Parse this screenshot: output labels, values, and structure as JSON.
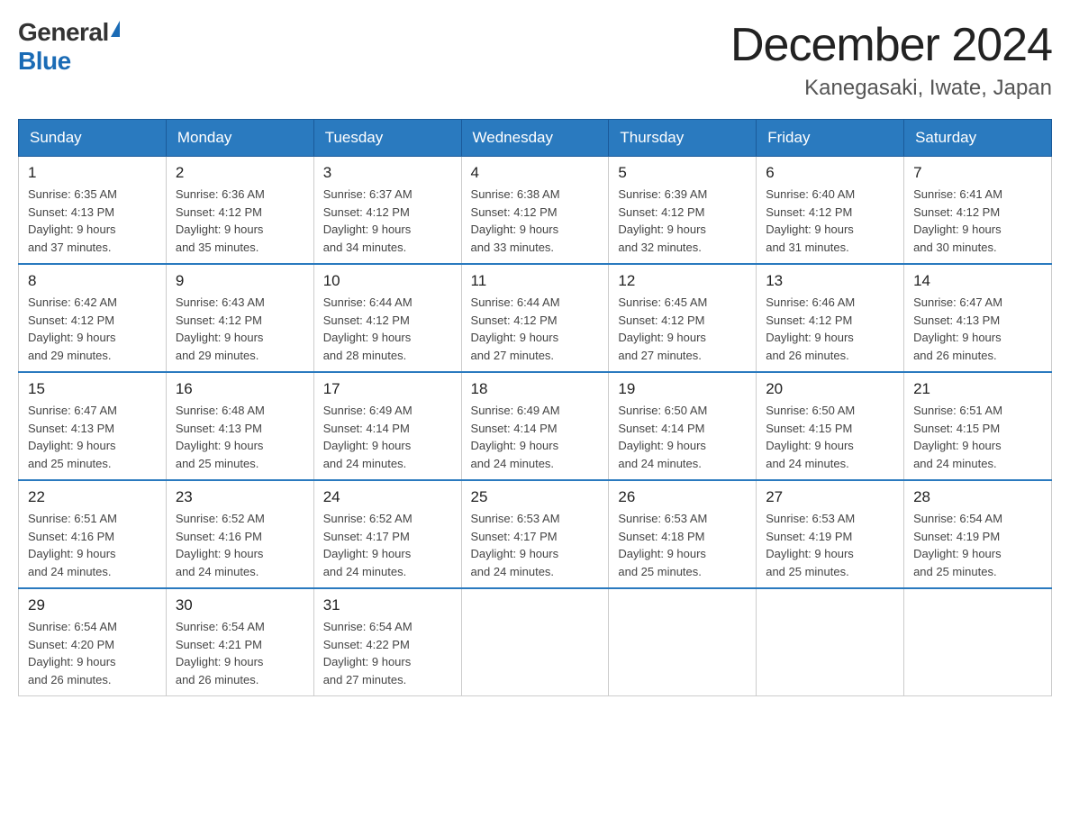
{
  "logo": {
    "general": "General",
    "blue": "Blue"
  },
  "title": "December 2024",
  "location": "Kanegasaki, Iwate, Japan",
  "days_of_week": [
    "Sunday",
    "Monday",
    "Tuesday",
    "Wednesday",
    "Thursday",
    "Friday",
    "Saturday"
  ],
  "weeks": [
    [
      {
        "day": "1",
        "sunrise": "6:35 AM",
        "sunset": "4:13 PM",
        "daylight": "9 hours and 37 minutes."
      },
      {
        "day": "2",
        "sunrise": "6:36 AM",
        "sunset": "4:12 PM",
        "daylight": "9 hours and 35 minutes."
      },
      {
        "day": "3",
        "sunrise": "6:37 AM",
        "sunset": "4:12 PM",
        "daylight": "9 hours and 34 minutes."
      },
      {
        "day": "4",
        "sunrise": "6:38 AM",
        "sunset": "4:12 PM",
        "daylight": "9 hours and 33 minutes."
      },
      {
        "day": "5",
        "sunrise": "6:39 AM",
        "sunset": "4:12 PM",
        "daylight": "9 hours and 32 minutes."
      },
      {
        "day": "6",
        "sunrise": "6:40 AM",
        "sunset": "4:12 PM",
        "daylight": "9 hours and 31 minutes."
      },
      {
        "day": "7",
        "sunrise": "6:41 AM",
        "sunset": "4:12 PM",
        "daylight": "9 hours and 30 minutes."
      }
    ],
    [
      {
        "day": "8",
        "sunrise": "6:42 AM",
        "sunset": "4:12 PM",
        "daylight": "9 hours and 29 minutes."
      },
      {
        "day": "9",
        "sunrise": "6:43 AM",
        "sunset": "4:12 PM",
        "daylight": "9 hours and 29 minutes."
      },
      {
        "day": "10",
        "sunrise": "6:44 AM",
        "sunset": "4:12 PM",
        "daylight": "9 hours and 28 minutes."
      },
      {
        "day": "11",
        "sunrise": "6:44 AM",
        "sunset": "4:12 PM",
        "daylight": "9 hours and 27 minutes."
      },
      {
        "day": "12",
        "sunrise": "6:45 AM",
        "sunset": "4:12 PM",
        "daylight": "9 hours and 27 minutes."
      },
      {
        "day": "13",
        "sunrise": "6:46 AM",
        "sunset": "4:12 PM",
        "daylight": "9 hours and 26 minutes."
      },
      {
        "day": "14",
        "sunrise": "6:47 AM",
        "sunset": "4:13 PM",
        "daylight": "9 hours and 26 minutes."
      }
    ],
    [
      {
        "day": "15",
        "sunrise": "6:47 AM",
        "sunset": "4:13 PM",
        "daylight": "9 hours and 25 minutes."
      },
      {
        "day": "16",
        "sunrise": "6:48 AM",
        "sunset": "4:13 PM",
        "daylight": "9 hours and 25 minutes."
      },
      {
        "day": "17",
        "sunrise": "6:49 AM",
        "sunset": "4:14 PM",
        "daylight": "9 hours and 24 minutes."
      },
      {
        "day": "18",
        "sunrise": "6:49 AM",
        "sunset": "4:14 PM",
        "daylight": "9 hours and 24 minutes."
      },
      {
        "day": "19",
        "sunrise": "6:50 AM",
        "sunset": "4:14 PM",
        "daylight": "9 hours and 24 minutes."
      },
      {
        "day": "20",
        "sunrise": "6:50 AM",
        "sunset": "4:15 PM",
        "daylight": "9 hours and 24 minutes."
      },
      {
        "day": "21",
        "sunrise": "6:51 AM",
        "sunset": "4:15 PM",
        "daylight": "9 hours and 24 minutes."
      }
    ],
    [
      {
        "day": "22",
        "sunrise": "6:51 AM",
        "sunset": "4:16 PM",
        "daylight": "9 hours and 24 minutes."
      },
      {
        "day": "23",
        "sunrise": "6:52 AM",
        "sunset": "4:16 PM",
        "daylight": "9 hours and 24 minutes."
      },
      {
        "day": "24",
        "sunrise": "6:52 AM",
        "sunset": "4:17 PM",
        "daylight": "9 hours and 24 minutes."
      },
      {
        "day": "25",
        "sunrise": "6:53 AM",
        "sunset": "4:17 PM",
        "daylight": "9 hours and 24 minutes."
      },
      {
        "day": "26",
        "sunrise": "6:53 AM",
        "sunset": "4:18 PM",
        "daylight": "9 hours and 25 minutes."
      },
      {
        "day": "27",
        "sunrise": "6:53 AM",
        "sunset": "4:19 PM",
        "daylight": "9 hours and 25 minutes."
      },
      {
        "day": "28",
        "sunrise": "6:54 AM",
        "sunset": "4:19 PM",
        "daylight": "9 hours and 25 minutes."
      }
    ],
    [
      {
        "day": "29",
        "sunrise": "6:54 AM",
        "sunset": "4:20 PM",
        "daylight": "9 hours and 26 minutes."
      },
      {
        "day": "30",
        "sunrise": "6:54 AM",
        "sunset": "4:21 PM",
        "daylight": "9 hours and 26 minutes."
      },
      {
        "day": "31",
        "sunrise": "6:54 AM",
        "sunset": "4:22 PM",
        "daylight": "9 hours and 27 minutes."
      },
      null,
      null,
      null,
      null
    ]
  ]
}
